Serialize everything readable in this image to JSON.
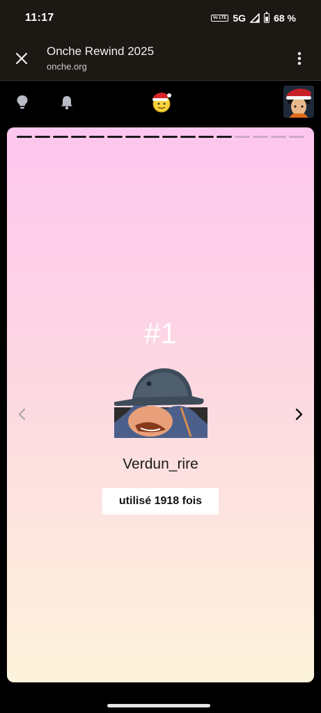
{
  "status_bar": {
    "time": "11:17",
    "volte": "Vo LTE",
    "network": "5G",
    "battery": "68 %"
  },
  "browser": {
    "title": "Onche Rewind 2025",
    "url": "onche.org",
    "icons": [
      "close-icon",
      "more-vert-icon"
    ]
  },
  "site_nav": {
    "icons": [
      "lightbulb-icon",
      "bell-icon",
      "santa-smiley-logo",
      "user-avatar"
    ]
  },
  "story": {
    "progress_total": 16,
    "progress_done": 12,
    "rank": "#1",
    "emoji_name": "Verdun_rire",
    "usage": "utilisé 1918 fois",
    "colors": {
      "gradient_top": "#fdc6ee",
      "gradient_bottom": "#fdf3dc"
    }
  }
}
